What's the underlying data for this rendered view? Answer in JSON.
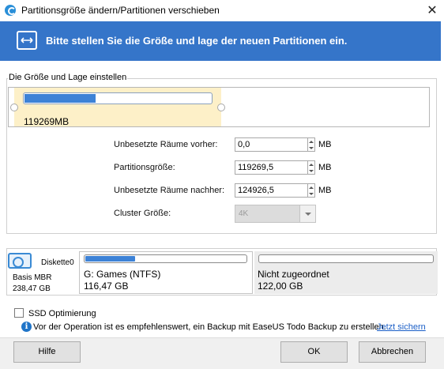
{
  "window": {
    "title": "Partitionsgröße ändern/Partitionen verschieben",
    "close_glyph": "✕"
  },
  "banner": {
    "text": "Bitte stellen Sie die Größe und lage der neuen Partitionen ein.",
    "icon": "resize-arrows-icon",
    "color": "#3575c9"
  },
  "size_group": {
    "legend": "Die Größe und Lage einstellen",
    "partition": {
      "size_label": "119269MB",
      "usage_fraction": 0.38
    },
    "fields": {
      "before": {
        "label": "Unbesetzte Räume vorher:",
        "value": "0,0",
        "unit": "MB"
      },
      "size": {
        "label": "Partitionsgröße:",
        "value": "119269,5",
        "unit": "MB"
      },
      "after": {
        "label": "Unbesetzte Räume nachher:",
        "value": "124926,5",
        "unit": "MB"
      },
      "cluster": {
        "label": "Cluster Größe:",
        "value": "4K"
      }
    }
  },
  "disk": {
    "name": "Diskette0",
    "type": "Basis MBR",
    "size": "238,47 GB",
    "partitions": [
      {
        "name": "G: Games (NTFS)",
        "size": "116,47 GB",
        "usage_fraction": 0.31
      },
      {
        "name": "Nicht zugeordnet",
        "size": "122,00 GB",
        "usage_fraction": 0
      }
    ]
  },
  "ssd": {
    "label": "SSD Optimierung",
    "checked": false
  },
  "info": {
    "text": "Vor der Operation ist es empfehlenswert, ein Backup mit  EaseUS Todo Backup zu erstellen.",
    "link": "Jetzt sichern"
  },
  "buttons": {
    "help": "Hilfe",
    "ok": "OK",
    "cancel": "Abbrechen"
  }
}
